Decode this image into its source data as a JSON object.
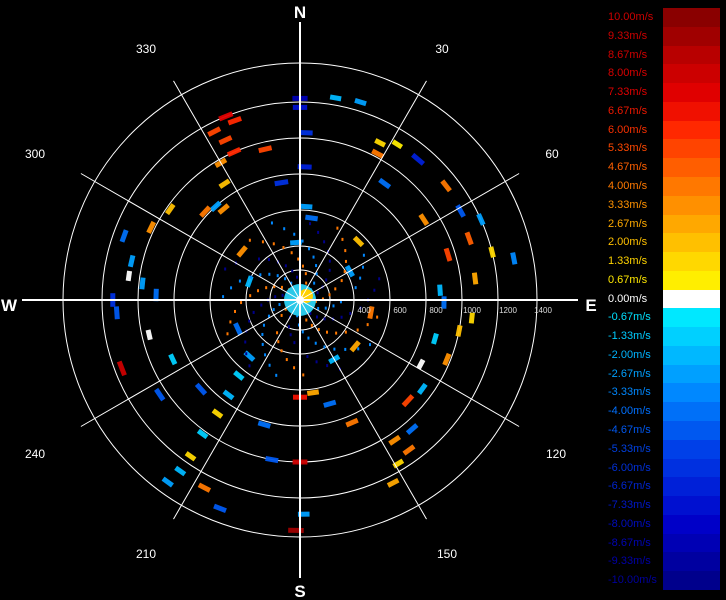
{
  "compass": {
    "north": "N",
    "south": "S",
    "east": "E",
    "west": "W"
  },
  "bearings": [
    "30",
    "60",
    "120",
    "150",
    "210",
    "240",
    "300",
    "330"
  ],
  "range_labels": [
    "400",
    "600",
    "800",
    "1000",
    "1200",
    "1400"
  ],
  "legend": {
    "labels": [
      "10.00m/s",
      "9.33m/s",
      "8.67m/s",
      "8.00m/s",
      "7.33m/s",
      "6.67m/s",
      "6.00m/s",
      "5.33m/s",
      "4.67m/s",
      "4.00m/s",
      "3.33m/s",
      "2.67m/s",
      "2.00m/s",
      "1.33m/s",
      "0.67m/s",
      "0.00m/s",
      "-0.67m/s",
      "-1.33m/s",
      "-2.00m/s",
      "-2.67m/s",
      "-3.33m/s",
      "-4.00m/s",
      "-4.67m/s",
      "-5.33m/s",
      "-6.00m/s",
      "-6.67m/s",
      "-7.33m/s",
      "-8.00m/s",
      "-8.67m/s",
      "-9.33m/s",
      "-10.00m/s"
    ],
    "colors": [
      "#8a0000",
      "#a00000",
      "#b80000",
      "#cc0000",
      "#e00000",
      "#f01000",
      "#ff2800",
      "#ff4400",
      "#ff5e00",
      "#ff7800",
      "#ff9000",
      "#ffa800",
      "#ffc000",
      "#ffd800",
      "#ffee00",
      "#ffffff",
      "#00e8ff",
      "#00d0ff",
      "#00b8ff",
      "#00a0ff",
      "#0088ff",
      "#0070f8",
      "#0058f0",
      "#0040e8",
      "#0030e0",
      "#0020d8",
      "#0010d0",
      "#0000c8",
      "#0000b4",
      "#0000a0",
      "#00008c"
    ],
    "label_colors": [
      "#cc0000",
      "#cc0000",
      "#d00000",
      "#d80000",
      "#e00000",
      "#ee1800",
      "#f83000",
      "#ff4800",
      "#ff6000",
      "#ff7a00",
      "#ff9200",
      "#ffaa00",
      "#ffc000",
      "#ffd400",
      "#ffe800",
      "#ffffff",
      "#00e0ff",
      "#00ccff",
      "#00b4ff",
      "#00a0ff",
      "#0088ff",
      "#0070ff",
      "#0058f0",
      "#0040e0",
      "#0030d8",
      "#0024d0",
      "#0018c8",
      "#000cc0",
      "#0004b4",
      "#0000a8",
      "#00009c"
    ]
  },
  "chart_data": {
    "type": "polar-radar",
    "range_ticks": [
      400,
      600,
      800,
      1000,
      1200,
      1400
    ],
    "bearings_deg": [
      30,
      60,
      120,
      150,
      210,
      240,
      300,
      330
    ],
    "velocity_range": [
      -10.0,
      10.0
    ],
    "velocity_unit": "m/s",
    "echoes": [
      {
        "az": 338,
        "r": 1200,
        "v": 7.3
      },
      {
        "az": 340,
        "r": 1160,
        "v": 6.0
      },
      {
        "az": 333,
        "r": 1150,
        "v": 5.3
      },
      {
        "az": 335,
        "r": 1080,
        "v": 5.3
      },
      {
        "az": 336,
        "r": 1000,
        "v": 6.0
      },
      {
        "az": 330,
        "r": 980,
        "v": 3.3
      },
      {
        "az": 327,
        "r": 870,
        "v": 2.0
      },
      {
        "az": 318,
        "r": 800,
        "v": -2.7
      },
      {
        "az": 320,
        "r": 760,
        "v": 3.3
      },
      {
        "az": 313,
        "r": 820,
        "v": 4.0
      },
      {
        "az": 305,
        "r": 980,
        "v": 2.0
      },
      {
        "az": 296,
        "r": 1020,
        "v": 3.3
      },
      {
        "az": 0,
        "r": 1220,
        "v": -8.7
      },
      {
        "az": 0,
        "r": 1170,
        "v": -7.3
      },
      {
        "az": 2,
        "r": 1030,
        "v": -6.0
      },
      {
        "az": 2,
        "r": 840,
        "v": -6.7
      },
      {
        "az": 8,
        "r": 560,
        "v": -4.0
      },
      {
        "az": 4,
        "r": 620,
        "v": -2.7
      },
      {
        "az": 10,
        "r": 1240,
        "v": -2.0
      },
      {
        "az": 17,
        "r": 1250,
        "v": -2.7
      },
      {
        "az": 27,
        "r": 1080,
        "v": 1.3
      },
      {
        "az": 32,
        "r": 1120,
        "v": 0.7
      },
      {
        "az": 28,
        "r": 1020,
        "v": 4.0
      },
      {
        "az": 36,
        "r": 900,
        "v": -4.0
      },
      {
        "az": 40,
        "r": 1120,
        "v": -6.7
      },
      {
        "az": 52,
        "r": 1130,
        "v": 4.0
      },
      {
        "az": 57,
        "r": 920,
        "v": 3.3
      },
      {
        "az": 61,
        "r": 1120,
        "v": -4.7
      },
      {
        "az": 66,
        "r": 1200,
        "v": -2.7
      },
      {
        "az": 70,
        "r": 1100,
        "v": 4.7
      },
      {
        "az": 73,
        "r": 960,
        "v": 5.3
      },
      {
        "az": 76,
        "r": 1200,
        "v": 1.3
      },
      {
        "az": 79,
        "r": 1310,
        "v": -3.3
      },
      {
        "az": 83,
        "r": 1080,
        "v": 2.7
      },
      {
        "az": 86,
        "r": 880,
        "v": -2.0
      },
      {
        "az": 91,
        "r": 900,
        "v": -4.0
      },
      {
        "az": 96,
        "r": 1060,
        "v": 1.3
      },
      {
        "az": 101,
        "r": 1000,
        "v": 2.0
      },
      {
        "az": 106,
        "r": 880,
        "v": -1.3
      },
      {
        "az": 112,
        "r": 980,
        "v": 3.3
      },
      {
        "az": 118,
        "r": 860,
        "v": 0.0
      },
      {
        "az": 126,
        "r": 940,
        "v": -2.0
      },
      {
        "az": 133,
        "r": 920,
        "v": 5.3
      },
      {
        "az": 139,
        "r": 1050,
        "v": -4.0
      },
      {
        "az": 144,
        "r": 1130,
        "v": 4.0
      },
      {
        "az": 149,
        "r": 1160,
        "v": 1.3
      },
      {
        "az": 153,
        "r": 1240,
        "v": 2.7
      },
      {
        "az": 146,
        "r": 1040,
        "v": 3.3
      },
      {
        "az": 157,
        "r": 840,
        "v": 4.0
      },
      {
        "az": 164,
        "r": 700,
        "v": -4.0
      },
      {
        "az": 172,
        "r": 620,
        "v": 2.7
      },
      {
        "az": 180,
        "r": 640,
        "v": 6.7
      },
      {
        "az": 180,
        "r": 1000,
        "v": 8.0
      },
      {
        "az": 179,
        "r": 1290,
        "v": -2.7
      },
      {
        "az": 181,
        "r": 1380,
        "v": 9.3
      },
      {
        "az": 190,
        "r": 1000,
        "v": -4.7
      },
      {
        "az": 196,
        "r": 820,
        "v": -4.0
      },
      {
        "az": 201,
        "r": 1340,
        "v": -4.7
      },
      {
        "az": 207,
        "r": 1270,
        "v": 4.0
      },
      {
        "az": 216,
        "r": 1350,
        "v": -2.7
      },
      {
        "az": 215,
        "r": 1260,
        "v": -2.0
      },
      {
        "az": 215,
        "r": 1160,
        "v": 1.3
      },
      {
        "az": 216,
        "r": 1020,
        "v": -1.3
      },
      {
        "az": 216,
        "r": 880,
        "v": 1.3
      },
      {
        "az": 217,
        "r": 760,
        "v": -2.0
      },
      {
        "az": 219,
        "r": 640,
        "v": -1.3
      },
      {
        "az": 222,
        "r": 520,
        "v": -2.7
      },
      {
        "az": 228,
        "r": 840,
        "v": -4.7
      },
      {
        "az": 236,
        "r": 1040,
        "v": -4.7
      },
      {
        "az": 245,
        "r": 880,
        "v": -1.3
      },
      {
        "az": 249,
        "r": 1160,
        "v": 8.0
      },
      {
        "az": 257,
        "r": 960,
        "v": 0.0
      },
      {
        "az": 266,
        "r": 1120,
        "v": -4.7
      },
      {
        "az": 270,
        "r": 1140,
        "v": -6.0
      },
      {
        "az": 272,
        "r": 900,
        "v": -4.0
      },
      {
        "az": 276,
        "r": 980,
        "v": -2.7
      },
      {
        "az": 278,
        "r": 1060,
        "v": 0.0
      },
      {
        "az": 283,
        "r": 1060,
        "v": -2.7
      },
      {
        "az": 290,
        "r": 1140,
        "v": -4.0
      },
      {
        "az": 351,
        "r": 760,
        "v": -6.0
      },
      {
        "az": 347,
        "r": 960,
        "v": 5.3
      },
      {
        "az": 356,
        "r": 420,
        "v": -2.7
      },
      {
        "az": 45,
        "r": 560,
        "v": 2.0
      },
      {
        "az": 60,
        "r": 420,
        "v": -2.7
      },
      {
        "az": 100,
        "r": 500,
        "v": 4.0
      },
      {
        "az": 130,
        "r": 500,
        "v": 2.7
      },
      {
        "az": 150,
        "r": 480,
        "v": -2.0
      },
      {
        "az": 245,
        "r": 480,
        "v": -4.0
      },
      {
        "az": 310,
        "r": 520,
        "v": 3.3
      },
      {
        "az": 290,
        "r": 400,
        "v": -2.0
      }
    ]
  }
}
